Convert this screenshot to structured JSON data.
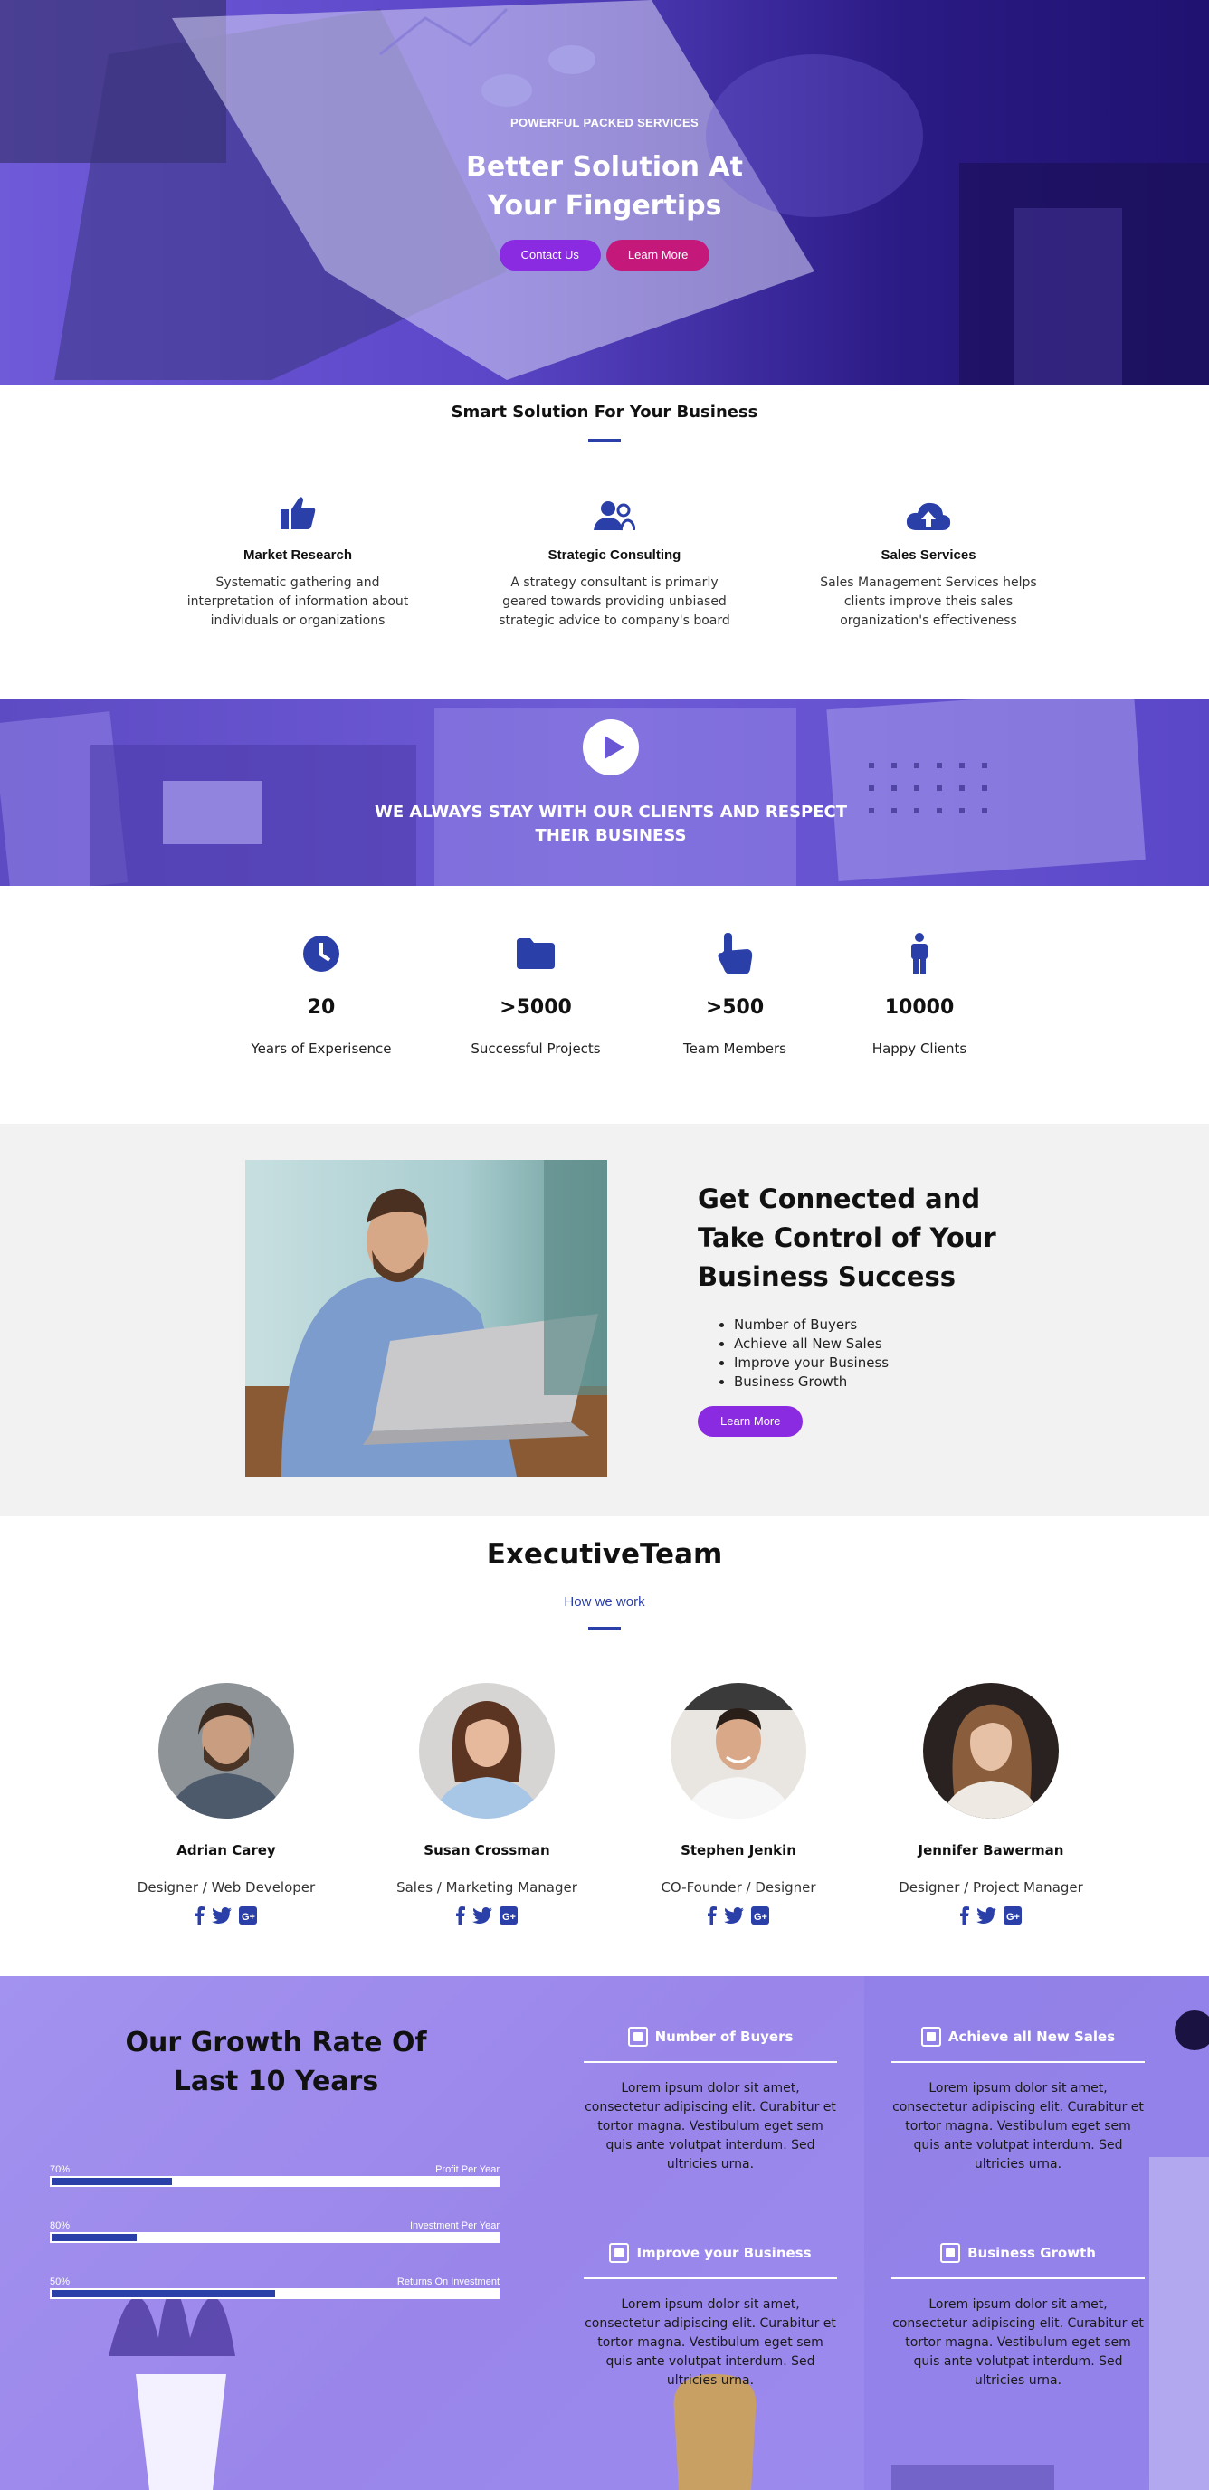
{
  "hero": {
    "eyebrow": "POWERFUL PACKED SERVICES",
    "title_line1": "Better Solution At",
    "title_line2": "Your Fingertips",
    "btn_contact": "Contact Us",
    "btn_learn": "Learn More"
  },
  "smart": {
    "title": "Smart Solution For Your Business",
    "features": [
      {
        "icon": "thumbs-up-icon",
        "title": "Market Research",
        "text": "Systematic gathering and interpretation of information about individuals or organizations"
      },
      {
        "icon": "users-icon",
        "title": "Strategic Consulting",
        "text": "A strategy consultant is primarly geared towards providing unbiased strategic advice to company's board"
      },
      {
        "icon": "cloud-upload-icon",
        "title": "Sales Services",
        "text": "Sales Management Services helps clients improve theis sales organization's effectiveness"
      }
    ]
  },
  "video": {
    "text": "WE ALWAYS STAY WITH OUR CLIENTS AND RESPECT THEIR BUSINESS"
  },
  "stats": [
    {
      "icon": "clock-icon",
      "value": "20",
      "label": "Years of Experisence"
    },
    {
      "icon": "folder-icon",
      "value": ">5000",
      "label": "Successful Projects"
    },
    {
      "icon": "pointing-hand-icon",
      "value": ">500",
      "label": "Team Members"
    },
    {
      "icon": "person-icon",
      "value": "10000",
      "label": "Happy Clients"
    }
  ],
  "connected": {
    "title": "Get Connected and Take Control of Your Business Success",
    "items": [
      "Number of Buyers",
      "Achieve all New Sales",
      "Improve your Business",
      "Business Growth"
    ],
    "button": "Learn More"
  },
  "team": {
    "title": "ExecutiveTeam",
    "subtitle": "How we work",
    "members": [
      {
        "name": "Adrian Carey",
        "role": "Designer / Web Developer"
      },
      {
        "name": "Susan Crossman",
        "role": "Sales / Marketing Manager"
      },
      {
        "name": "Stephen Jenkin",
        "role": "CO-Founder / Designer"
      },
      {
        "name": "Jennifer Bawerman",
        "role": "Designer / Project Manager"
      }
    ]
  },
  "growth": {
    "title": "Our Growth Rate Of Last 10 Years",
    "bars": [
      {
        "percent_label": "70%",
        "label": "Profit Per Year",
        "fill": 0.27
      },
      {
        "percent_label": "80%",
        "label": "Investment Per Year",
        "fill": 0.19
      },
      {
        "percent_label": "50%",
        "label": "Returns On Investment",
        "fill": 0.5
      }
    ],
    "cards": [
      {
        "title": "Number of Buyers",
        "text": "Lorem ipsum dolor sit amet, consectetur adipiscing elit. Curabitur et tortor magna. Vestibulum eget sem quis ante volutpat interdum. Sed ultricies urna."
      },
      {
        "title": "Achieve all New Sales",
        "text": "Lorem ipsum dolor sit amet, consectetur adipiscing elit. Curabitur et tortor magna. Vestibulum eget sem quis ante volutpat interdum. Sed ultricies urna."
      },
      {
        "title": "Improve your Business",
        "text": "Lorem ipsum dolor sit amet, consectetur adipiscing elit. Curabitur et tortor magna. Vestibulum eget sem quis ante volutpat interdum. Sed ultricies urna."
      },
      {
        "title": "Business Growth",
        "text": "Lorem ipsum dolor sit amet, consectetur adipiscing elit. Curabitur et tortor magna. Vestibulum eget sem quis ante volutpat interdum. Sed ultricies urna."
      }
    ]
  },
  "colors": {
    "accent_blue": "#2a3fa8",
    "purple_button": "#8a2be2",
    "pink_button": "#c4197a"
  }
}
